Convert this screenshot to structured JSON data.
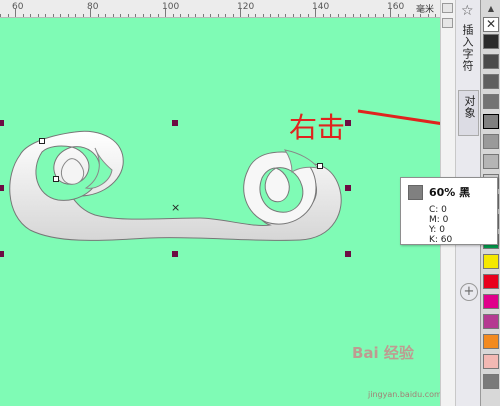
{
  "ruler": {
    "labels": [
      "60",
      "80",
      "100",
      "120",
      "140",
      "160"
    ],
    "unit": "毫米"
  },
  "docker": {
    "tab_label": "插入字符",
    "tab2_label": "对象"
  },
  "annotation": {
    "text": "右击"
  },
  "tooltip": {
    "title": "60% 黑",
    "c": "C: 0",
    "m": "M: 0",
    "y": "Y: 0",
    "k": "K: 60"
  },
  "palette": {
    "none_glyph": "✕",
    "swatches": [
      "#2b2b2b",
      "#4a4a4a",
      "#5f5f5f",
      "#737373",
      "#808080",
      "#9a9a9a",
      "#b5b5b5",
      "#cccccc",
      "#e3e3e3",
      "#0aa5e8",
      "#009a4b",
      "#f5e800",
      "#e8001d",
      "#e0008a",
      "#b53a91",
      "#f28a1f",
      "#f2b8b3",
      "#7a7a7a"
    ],
    "selected_color": "#808080"
  },
  "colors": {
    "canvas": "#7ffbb5",
    "handle": "#6d0c43",
    "annotation": "#e0231e"
  },
  "watermark": {
    "brand": "Bai 经验",
    "url": "jingyan.baidu.com"
  }
}
